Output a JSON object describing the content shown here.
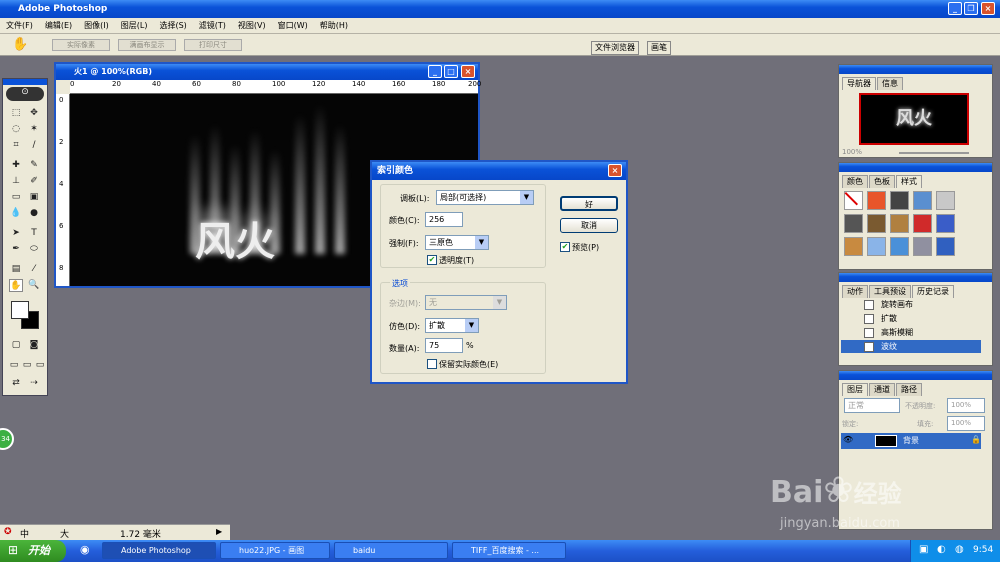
{
  "app": {
    "title": "Adobe Photoshop"
  },
  "menu": [
    "文件(F)",
    "编辑(E)",
    "图像(I)",
    "图层(L)",
    "选择(S)",
    "滤镜(T)",
    "视图(V)",
    "窗口(W)",
    "帮助(H)"
  ],
  "options": {
    "actual_pixels": "实际像素",
    "fit_screen": "满画布显示",
    "print_size": "打印尺寸",
    "file_browser": "文件浏览器",
    "brushes": "画笔"
  },
  "document": {
    "title": "火1 @ 100%(RGB)",
    "canvas_text": "风火",
    "ruler_labels": [
      "0",
      "20",
      "40",
      "60",
      "80",
      "100",
      "120",
      "140",
      "160",
      "180",
      "200"
    ],
    "vruler_labels": [
      "0",
      "2",
      "4",
      "6",
      "8"
    ]
  },
  "dialog": {
    "title": "索引颜色",
    "palette_label": "调板(L):",
    "palette_value": "局部(可选择)",
    "colors_label": "颜色(C):",
    "colors_value": "256",
    "forced_label": "强制(F):",
    "forced_value": "三原色",
    "transparency_label": "透明度(T)",
    "options_title": "选项",
    "matte_label": "杂边(M):",
    "matte_value": "无",
    "dither_label": "仿色(D):",
    "dither_value": "扩散",
    "amount_label": "数量(A):",
    "amount_value": "75",
    "amount_unit": "%",
    "preserve_label": "保留实际颜色(E)",
    "ok": "好",
    "cancel": "取消",
    "preview": "预览(P)"
  },
  "navigator": {
    "tabs": [
      "导航器",
      "信息"
    ],
    "zoom": "100%",
    "thumb_text": "风火"
  },
  "swatches": {
    "tabs": [
      "颜色",
      "色板",
      "样式"
    ],
    "colors": [
      "#ffffff",
      "#e8552b",
      "#444444",
      "#5a8fd0",
      "#c8c8c8",
      "#555555",
      "#7a5a30",
      "#b08040",
      "#d02a2a",
      "#3a5dc8",
      "#c88a40",
      "#8ab4e8",
      "#4a90d8",
      "#9090a0",
      "#3060c0"
    ]
  },
  "history": {
    "tabs": [
      "动作",
      "工具预设",
      "历史记录"
    ],
    "items": [
      "旋转画布",
      "扩散",
      "高斯模糊",
      "波纹"
    ]
  },
  "layers": {
    "tabs": [
      "图层",
      "通道",
      "路径"
    ],
    "blend": "正常",
    "opacity_label": "不透明度:",
    "opacity": "100%",
    "lock_label": "锁定:",
    "fill_label": "填充:",
    "fill": "100%",
    "layer_name": "背景"
  },
  "status": {
    "ime": "中",
    "size": "大",
    "value": "1.72 毫米"
  },
  "badge": "34",
  "taskbar": {
    "start": "开始",
    "tasks": [
      "Adobe Photoshop",
      "huo22.JPG - 画图",
      "baidu",
      "TIFF_百度搜索 - ..."
    ],
    "time": "9:54"
  },
  "watermark": {
    "brand": "Bai",
    "brand2": "经验",
    "url": "jingyan.baidu.com"
  }
}
